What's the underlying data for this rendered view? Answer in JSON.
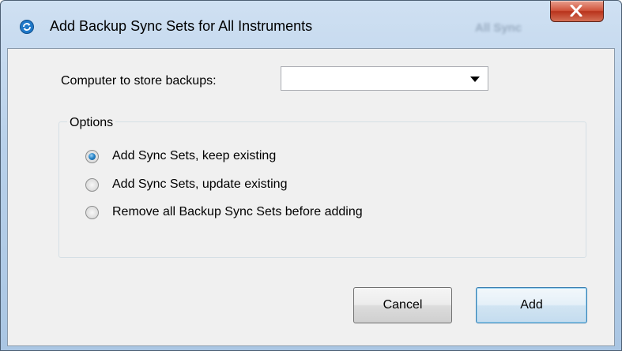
{
  "window": {
    "title": "Add Backup Sync Sets for All Instruments",
    "background_title_fragment": "All Sync",
    "close_label": "X"
  },
  "form": {
    "computer_label": "Computer to store backups:",
    "computer_value": ""
  },
  "options": {
    "legend": "Options",
    "items": [
      {
        "label": "Add Sync Sets, keep existing",
        "checked": true
      },
      {
        "label": "Add Sync Sets, update existing",
        "checked": false
      },
      {
        "label": "Remove all Backup Sync Sets before adding",
        "checked": false
      }
    ]
  },
  "buttons": {
    "cancel": "Cancel",
    "add": "Add"
  },
  "colors": {
    "accent": "#2a86c8",
    "close_red": "#c7432a",
    "dialog_bg": "#f0f0f0"
  }
}
